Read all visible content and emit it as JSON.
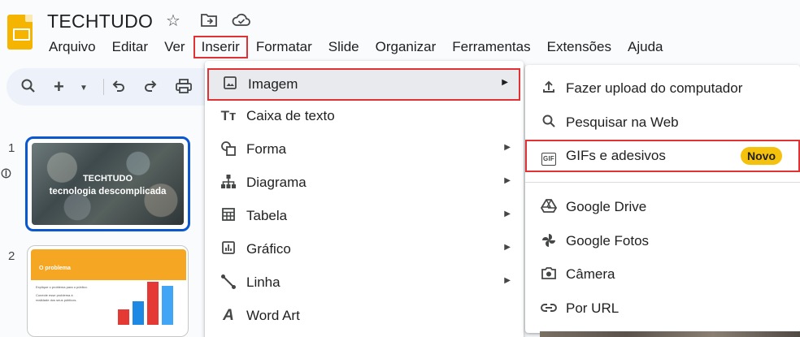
{
  "app": {
    "doc_title": "TECHTUDO",
    "brand_color": "#f4b400"
  },
  "title_icons": [
    "star-icon",
    "move-to-folder-icon",
    "cloud-saved-icon"
  ],
  "menubar": [
    {
      "label": "Arquivo",
      "active": false
    },
    {
      "label": "Editar",
      "active": false
    },
    {
      "label": "Ver",
      "active": false
    },
    {
      "label": "Inserir",
      "active": true
    },
    {
      "label": "Formatar",
      "active": false
    },
    {
      "label": "Slide",
      "active": false
    },
    {
      "label": "Organizar",
      "active": false
    },
    {
      "label": "Ferramentas",
      "active": false
    },
    {
      "label": "Extensões",
      "active": false
    },
    {
      "label": "Ajuda",
      "active": false
    }
  ],
  "toolbar": [
    "search-icon",
    "new-slide-icon",
    "dropdown-icon",
    "undo-icon",
    "redo-icon",
    "print-icon"
  ],
  "slides": [
    {
      "number": "1",
      "title": "TECHTUDO",
      "subtitle": "tecnologia descomplicada",
      "selected": true
    },
    {
      "number": "2",
      "title": "O problema",
      "lines": [
        "Explique o problema para o público.",
        "Conecte esse problema à",
        "realidade dos seus públicos."
      ],
      "bar_values": [
        20,
        30,
        55,
        50
      ],
      "bar_colors": [
        "#e53935",
        "#1e88e5",
        "#e53935",
        "#42a5f5"
      ]
    }
  ],
  "insert_menu": {
    "items": [
      {
        "label": "Imagem",
        "icon": "image-icon",
        "submenu": true,
        "highlighted": true
      },
      {
        "label": "Caixa de texto",
        "icon": "text-box-icon",
        "submenu": false
      },
      {
        "label": "Forma",
        "icon": "shape-icon",
        "submenu": true
      },
      {
        "label": "Diagrama",
        "icon": "diagram-icon",
        "submenu": true
      },
      {
        "label": "Tabela",
        "icon": "table-icon",
        "submenu": true
      },
      {
        "label": "Gráfico",
        "icon": "chart-icon",
        "submenu": true
      },
      {
        "label": "Linha",
        "icon": "line-icon",
        "submenu": true
      },
      {
        "label": "Word Art",
        "icon": "word-art-icon",
        "submenu": false
      }
    ]
  },
  "image_submenu": {
    "items": [
      {
        "label": "Fazer upload do computador",
        "icon": "upload-icon"
      },
      {
        "label": "Pesquisar na Web",
        "icon": "search-icon"
      },
      {
        "label": "GIFs e adesivos",
        "icon": "gif-icon",
        "badge": "Novo",
        "highlighted": true
      },
      {
        "label": "Google Drive",
        "icon": "google-drive-icon"
      },
      {
        "label": "Google Fotos",
        "icon": "google-photos-icon"
      },
      {
        "label": "Câmera",
        "icon": "camera-icon"
      },
      {
        "label": "Por URL",
        "icon": "link-icon"
      }
    ],
    "badge_color": "#f4c20d",
    "highlight_color": "#e03134"
  }
}
